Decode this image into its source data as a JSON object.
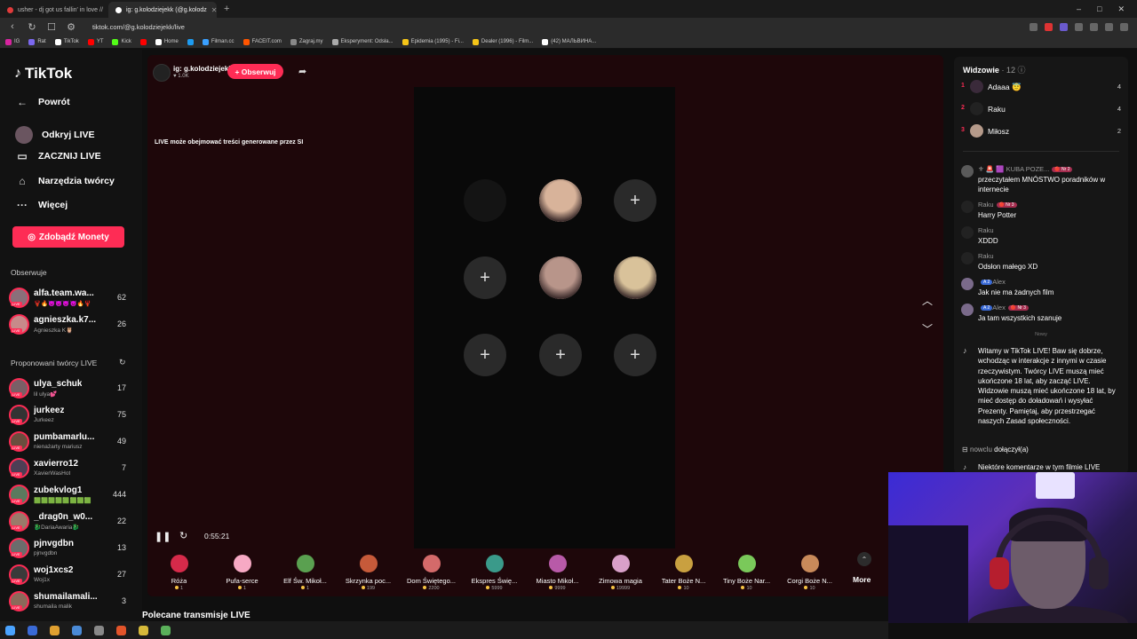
{
  "browser": {
    "tabs": [
      {
        "title": "usher - dj got us fallin' in love //",
        "active": false,
        "favicon_color": "#e03b3b"
      },
      {
        "title": "ig: g.kolodziejekk (@g.kolodz",
        "active": true,
        "favicon_color": "#ffffff"
      }
    ],
    "new_tab": "+",
    "window_controls": [
      "–",
      "□",
      "✕"
    ],
    "url": "tiktok.com/@g.kolodziejekk/live",
    "bookmarks": [
      {
        "label": "IG",
        "color": "#d6249f"
      },
      {
        "label": "Rat",
        "color": "#7b68ee"
      },
      {
        "label": "TikTok",
        "color": "#ffffff"
      },
      {
        "label": "YT",
        "color": "#ff0000"
      },
      {
        "label": "Kick",
        "color": "#53fc18"
      },
      {
        "label": "",
        "color": "#ff0000"
      },
      {
        "label": "Home",
        "color": "#ffffff"
      },
      {
        "label": "",
        "color": "#1d9bf0"
      },
      {
        "label": "Filman.cc",
        "color": "#3aa0ff"
      },
      {
        "label": "FACEIT.com",
        "color": "#ff5500"
      },
      {
        "label": "Zagraj.my",
        "color": "#888888"
      },
      {
        "label": "Eksperyment: Odsła...",
        "color": "#aaaaaa"
      },
      {
        "label": "Epidemia (1995) - Fi...",
        "color": "#f5c518"
      },
      {
        "label": "Dealer (1996) - Film...",
        "color": "#f5c518"
      },
      {
        "label": "(42) МАЛЬВИНА...",
        "color": "#ffffff"
      }
    ]
  },
  "sidebar": {
    "logo": "TikTok",
    "menu": [
      {
        "label": "Powrót",
        "icon": "back-arrow-icon",
        "glyph": "←"
      },
      {
        "label": "Odkryj LIVE",
        "icon": "live-avatar-icon",
        "glyph": "◉"
      },
      {
        "label": "ZACZNIJ LIVE",
        "icon": "camera-icon",
        "glyph": "▭"
      },
      {
        "label": "Narzędzia twórcy",
        "icon": "house-icon",
        "glyph": "⌂"
      },
      {
        "label": "Więcej",
        "icon": "more-icon",
        "glyph": "···"
      }
    ],
    "coins_button": "Zdobądź Monety",
    "following_title": "Obserwuje",
    "following": [
      {
        "name": "alfa.team.wa...",
        "sub": "🦞🔥😈😈😈😈🔥🦞",
        "count": "62",
        "color": "#8a6f7a"
      },
      {
        "name": "agnieszka.k7...",
        "sub": "Agnieszka K🦉",
        "count": "26",
        "color": "#c78a8a"
      }
    ],
    "suggested_title": "Proponowani twórcy LIVE",
    "refresh_icon": "refresh-icon",
    "suggested": [
      {
        "name": "ulya_schuk",
        "sub": "lil ulya💕",
        "count": "17",
        "color": "#7a5f66"
      },
      {
        "name": "jurkeez",
        "sub": "Jurkeez",
        "count": "75",
        "color": "#333333"
      },
      {
        "name": "pumbamarlu...",
        "sub": "nienażarty mariusz",
        "count": "49",
        "color": "#6a4e3e"
      },
      {
        "name": "xavierro12",
        "sub": "XavierWasHot",
        "count": "7",
        "color": "#4e3e55"
      },
      {
        "name": "zubekvlog1",
        "sub": "🟩🟩🟩🟩🟩🟩🟩🟩",
        "count": "444",
        "color": "#5b7a5e"
      },
      {
        "name": "_drag0n_w0...",
        "sub": "🐉DariaAwaria🐉",
        "count": "22",
        "color": "#9a7a6a"
      },
      {
        "name": "pjnvgdbn",
        "sub": "pjnvgdbn",
        "count": "13",
        "color": "#6c6c6c"
      },
      {
        "name": "woj1xcs2",
        "sub": "Woj1x",
        "count": "27",
        "color": "#3a3a3a"
      },
      {
        "name": "shumailamali...",
        "sub": "shumaila malik",
        "count": "3",
        "color": "#8b6a5a"
      }
    ],
    "live_tag": "LIVE"
  },
  "stream": {
    "host_name": "ig: g.kolodziejekk",
    "host_likes": "♥ 1.0K",
    "follow_label": "+ Obserwuj",
    "share_icon": "share-icon",
    "ai_notice": "LIVE może obejmować treści generowane przez SI",
    "slots": [
      {
        "type": "blank"
      },
      {
        "type": "face",
        "color": "#d8b39a"
      },
      {
        "type": "add",
        "label": "+"
      },
      {
        "type": "add",
        "label": "+"
      },
      {
        "type": "face",
        "color": "#b8958a"
      },
      {
        "type": "face",
        "color": "#d9c29a"
      },
      {
        "type": "add",
        "label": "+"
      },
      {
        "type": "add",
        "label": "+"
      },
      {
        "type": "add",
        "label": "+"
      }
    ],
    "timer": "0:55:21",
    "pause_icon": "pause-icon",
    "refresh_icon": "refresh-icon",
    "settings_icon": "gear-icon",
    "recommended_title": "Polecane transmisje LIVE"
  },
  "gifts": [
    {
      "name": "Róża",
      "price": "1",
      "color": "#d62a4a"
    },
    {
      "name": "Pufa-serce",
      "price": "1",
      "color": "#f7a9c4"
    },
    {
      "name": "Elf Św. Mikoł...",
      "price": "1",
      "color": "#5aa050"
    },
    {
      "name": "Skrzynka poc...",
      "price": "199",
      "color": "#c65a3a"
    },
    {
      "name": "Dom Świętego...",
      "price": "2200",
      "color": "#d46a6a"
    },
    {
      "name": "Ekspres Świę...",
      "price": "5999",
      "color": "#3a9a8a"
    },
    {
      "name": "Miasto Mikoł...",
      "price": "9999",
      "color": "#b85aa8"
    },
    {
      "name": "Zimowa magia",
      "price": "19999",
      "color": "#d9a0c9"
    },
    {
      "name": "Tater Boże N...",
      "price": "10",
      "color": "#c9a040"
    },
    {
      "name": "Tiny Boże Nar...",
      "price": "10",
      "color": "#7ac95a"
    },
    {
      "name": "Corgi Boże N...",
      "price": "10",
      "color": "#c98a5a"
    }
  ],
  "gifts_more": "More",
  "gifts_more_icon": "chevron-up-icon",
  "chat": {
    "viewers_title": "Widzowie",
    "viewers_count": "· 12",
    "info_icon": "info-icon",
    "viewers": [
      {
        "rank": "1",
        "name": "Adaaa 😇",
        "count": "4",
        "color": "#3a2a3a"
      },
      {
        "rank": "2",
        "name": "Raku",
        "count": "4",
        "color": "#222222"
      },
      {
        "rank": "3",
        "name": "Miłosz",
        "count": "2",
        "color": "#b59a8a"
      }
    ],
    "messages": [
      {
        "user": "⚜ 🚨 🟪 KUBA POZE...",
        "badge": "🔴 Nr 2",
        "text": "przeczytałem MNÓSTWO poradników w internecie",
        "color": "#5a5a5a"
      },
      {
        "user": "Raku",
        "badge": "🔴 Nr 3",
        "text": "Harry Potter",
        "color": "#222222"
      },
      {
        "user": "Raku",
        "badge": "",
        "text": "XDDD",
        "color": "#222222"
      },
      {
        "user": "Raku",
        "badge": "",
        "text": "Odsłon małego XD",
        "color": "#222222"
      },
      {
        "user": "Alex",
        "level": "A 2",
        "badge": "",
        "text": "Jak nie ma żadnych film",
        "color": "#7a6a8a"
      },
      {
        "user": "Alex",
        "level": "A 2",
        "badge": "🔴 Nr 3",
        "text": "Ja tam wszystkich szanuje",
        "color": "#7a6a8a"
      }
    ],
    "new_divider": "Nowy",
    "system_message": "Witamy w TikTok LIVE! Baw się dobrze, wchodząc w interakcje z innymi w czasie rzeczywistym. Twórcy LIVE muszą mieć ukończone 18 lat, aby zacząć LIVE. Widzowie muszą mieć ukończone 18 lat, by mieć dostęp do doładowań i wysyłać Prezenty. Pamiętaj, aby przestrzegać naszych Zasad społeczności.",
    "join_user": "nowclu",
    "join_text": "dołączył(a)",
    "last_message": "Niektóre komentarze w tym filmie LIVE"
  },
  "colors": {
    "accent": "#fe2c55",
    "stage_bg": "#1e070a",
    "panel_bg": "#161616"
  }
}
